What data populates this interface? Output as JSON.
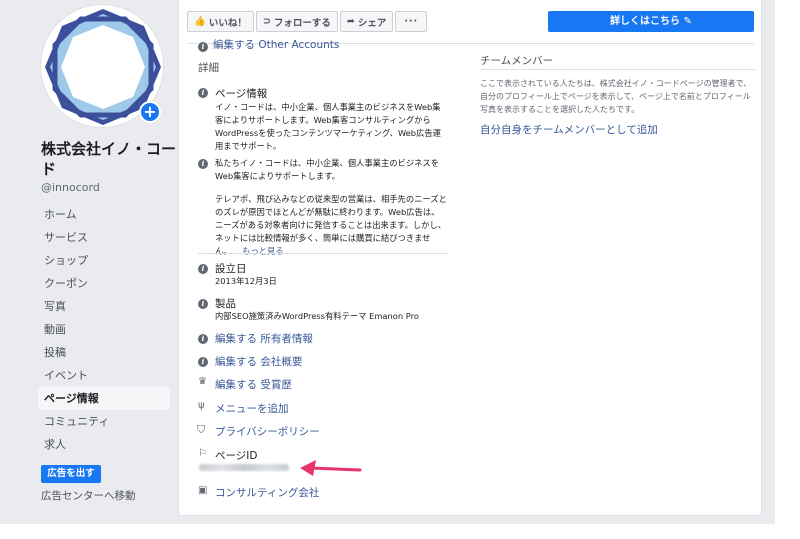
{
  "page": {
    "name": "株式会社イノ・コード",
    "handle": "@innocord"
  },
  "nav": {
    "items": [
      "ホーム",
      "サービス",
      "ショップ",
      "クーポン",
      "写真",
      "動画",
      "投稿",
      "イベント",
      "ページ情報",
      "コミュニティ",
      "求人"
    ],
    "active_index": 8
  },
  "promote": {
    "button": "広告を出す",
    "ad_center": "広告センターへ移動"
  },
  "actions": {
    "like": "いいね！",
    "follow": "フォローする",
    "share": "シェア",
    "more": "···",
    "learn_more": "詳しくはこちら"
  },
  "about": {
    "top_link": "編集する Other Accounts",
    "section_title": "詳細",
    "page_info": {
      "title": "ページ情報",
      "desc": "イノ・コードは、中小企業、個人事業主のビジネスをWeb集客によりサポートします。Web集客コンサルティングからWordPressを使ったコンテンツマーケティング、Web広告運用までサポート。",
      "story_p1": "私たちイノ・コードは、中小企業、個人事業主のビジネスをWeb集客によりサポートします。",
      "story_p2": "テレアポ、飛び込みなどの従来型の営業は、相手先のニーズとのズレが原因でほとんどが無駄に終わります。Web広告は、ニーズがある対象者向けに発信することは出来ます。しかし、ネットには比較情報が多く、簡単には購買に結びつきません。...",
      "more": "もっと見る"
    },
    "founded": {
      "label": "設立日",
      "value": "2013年12月3日"
    },
    "products": {
      "label": "製品",
      "value": "内部SEO施策済みWordPress有料テーマ Emanon Pro"
    },
    "edit_owner": "編集する 所有者情報",
    "edit_overview": "編集する 会社概要",
    "edit_awards": "編集する 受賞歴",
    "add_menu": "メニューを追加",
    "privacy": "プライバシーポリシー",
    "page_id_label": "ページID",
    "category": "コンサルティング会社"
  },
  "team": {
    "title": "チームメンバー",
    "desc": "ここで表示されている人たちは、株式会社イノ・コードページの管理者で、自分のプロフィール上でページを表示して、ページ上で名前とプロフィール写真を表示することを選択した人たちです。",
    "link": "自分自身をチームメンバーとして追加"
  },
  "colors": {
    "accent": "#1877f2",
    "link": "#385898",
    "arrow": "#e8336d",
    "background": "#e9ebee"
  }
}
